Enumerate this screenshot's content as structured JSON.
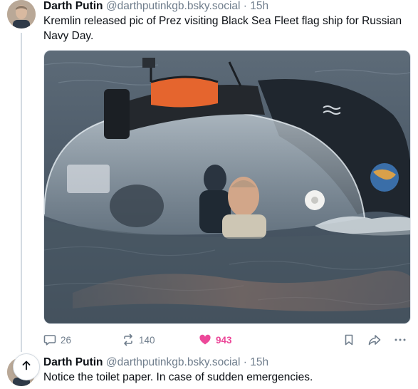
{
  "posts": [
    {
      "author": "Darth Putin",
      "handle": "@darthputinkgb.bsky.social",
      "separator": "·",
      "time": "15h",
      "text": "Kremlin released pic of Prez visiting Black Sea Fleet flag ship for Russian Navy Day.",
      "stats": {
        "replies": "26",
        "reposts": "140",
        "likes": "943"
      },
      "liked": true
    },
    {
      "author": "Darth Putin",
      "handle": "@darthputinkgb.bsky.social",
      "separator": "·",
      "time": "15h",
      "text": "Notice the toilet paper. In case of sudden emergencies."
    }
  ],
  "icons": {
    "reply": "speech-bubble-icon",
    "repost": "repost-arrows-icon",
    "like": "heart-icon",
    "bookmark": "bookmark-icon",
    "share": "share-arrow-icon",
    "more": "ellipsis-icon",
    "scroll_top": "arrow-up-icon"
  },
  "colors": {
    "like": "#ec4899",
    "muted": "#6f7d8c",
    "text": "#0b0f14"
  }
}
